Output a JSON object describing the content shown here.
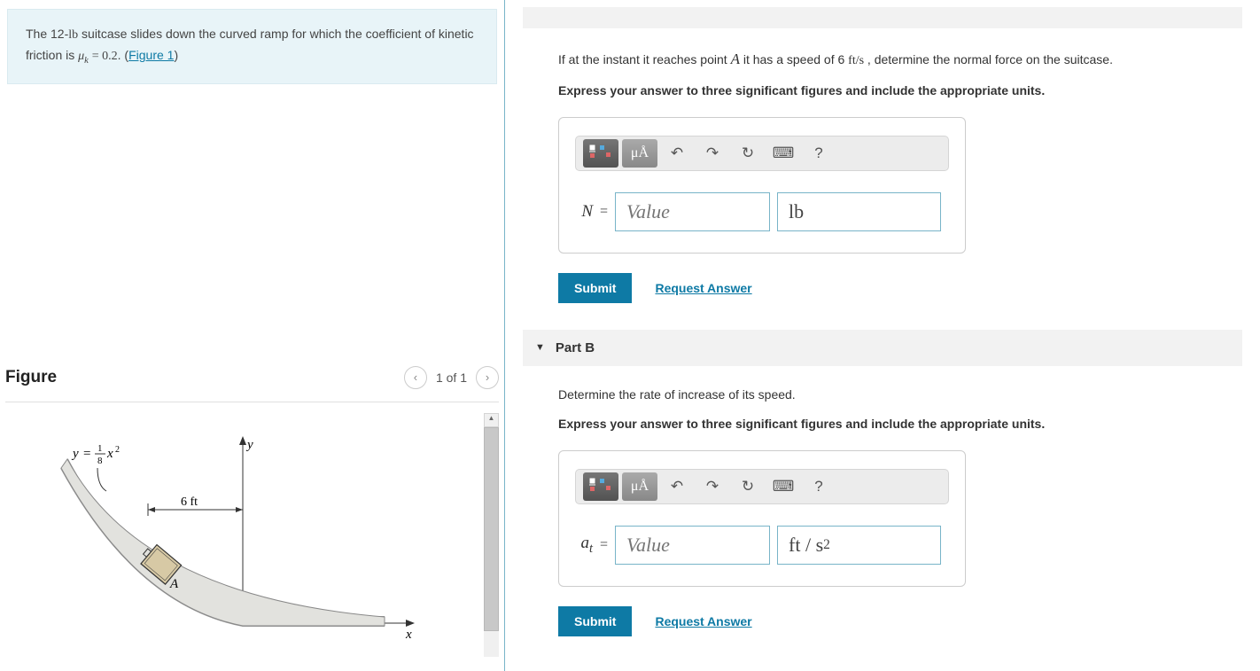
{
  "problem": {
    "text_pre": "The 12-",
    "unit1": "lb",
    "text_mid": " suitcase slides down the curved ramp for which the coefficient of kinetic friction is ",
    "mu": "μₖ = 0.2",
    "text_post": ". (",
    "figure_link": "Figure 1",
    "text_close": ")"
  },
  "figure": {
    "title": "Figure",
    "counter": "1 of 1",
    "equation": "y = (1/8)x²",
    "dimension": "6 ft",
    "point": "A"
  },
  "partA": {
    "question_pre": "If at the instant it reaches point ",
    "point": "A",
    "question_mid": " it has a speed of 6 ",
    "units_speed": "ft/s",
    "question_post": " , determine the normal force on the suitcase.",
    "instruction": "Express your answer to three significant figures and include the appropriate units.",
    "var": "N",
    "placeholder": "Value",
    "unit": "lb",
    "toolbar": {
      "units": "μÅ",
      "help": "?"
    },
    "submit": "Submit",
    "request": "Request Answer"
  },
  "partB": {
    "title": "Part B",
    "question": "Determine the rate of increase of its speed.",
    "instruction": "Express your answer to three significant figures and include the appropriate units.",
    "var": "aₜ",
    "placeholder": "Value",
    "unit_html": "ft / s²",
    "toolbar": {
      "units": "μÅ",
      "help": "?"
    },
    "submit": "Submit",
    "request": "Request Answer"
  }
}
